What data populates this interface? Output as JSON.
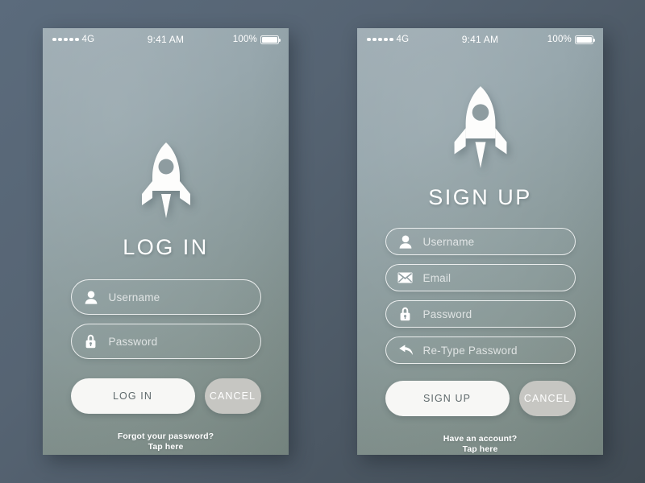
{
  "status_bar": {
    "carrier": "4G",
    "signal_dots": 5,
    "time": "9:41 AM",
    "battery_percent": "100%"
  },
  "login_screen": {
    "logo_icon": "rocket-icon",
    "title": "LOG IN",
    "fields": [
      {
        "icon": "user-icon",
        "placeholder": "Username",
        "value": ""
      },
      {
        "icon": "lock-icon",
        "placeholder": "Password",
        "value": ""
      }
    ],
    "primary_button": "LOG IN",
    "cancel_button": "CANCEL",
    "footer_line1": "Forgot your password?",
    "footer_line2": "Tap here"
  },
  "signup_screen": {
    "logo_icon": "rocket-icon",
    "title": "SIGN UP",
    "fields": [
      {
        "icon": "user-icon",
        "placeholder": "Username",
        "value": ""
      },
      {
        "icon": "envelope-icon",
        "placeholder": "Email",
        "value": ""
      },
      {
        "icon": "lock-icon",
        "placeholder": "Password",
        "value": ""
      },
      {
        "icon": "retype-arrow-icon",
        "placeholder": "Re-Type Password",
        "value": ""
      }
    ],
    "primary_button": "SIGN UP",
    "cancel_button": "CANCEL",
    "footer_line1": "Have an account?",
    "footer_line2": "Tap here"
  },
  "colors": {
    "page_background": "#566473",
    "screen_top": "#9fadb4",
    "screen_bottom": "#7d8c86",
    "primary_button_bg": "#f7f7f5",
    "primary_button_text": "#5f6a6c",
    "cancel_button_bg": "#c6c6c2",
    "text_white": "#ffffff"
  }
}
